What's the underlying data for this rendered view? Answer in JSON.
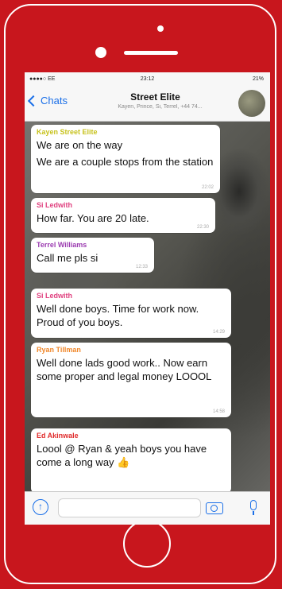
{
  "status": {
    "carrier": "●●●●○ EE",
    "time": "23:12",
    "battery": "21%"
  },
  "nav": {
    "back_label": "Chats",
    "title": "Street Elite",
    "subtitle": "Kayen, Prince, Si, Terrel, +44 74..."
  },
  "messages": [
    {
      "sender": "Kayen Street Elite",
      "color": "#c7c21c",
      "lines": [
        "We are on the way",
        "We are a couple stops from the station"
      ],
      "time": "22:02"
    },
    {
      "sender": "Si Ledwith",
      "color": "#e0407f",
      "lines": [
        "How far. You are 20 late."
      ],
      "time": "22:30"
    },
    {
      "sender": "Terrel Williams",
      "color": "#9b3bb0",
      "lines": [
        "Call me pls si"
      ],
      "time": "12:33"
    },
    {
      "sender": "Si Ledwith",
      "color": "#e0407f",
      "lines": [
        "Well done boys. Time for work now. Proud of you boys."
      ],
      "time": "14:29"
    },
    {
      "sender": "Ryan Tillman",
      "color": "#f0872a",
      "lines": [
        "Well done lads good work.. Now earn some proper and legal money LOOOL"
      ],
      "time": "14:58"
    },
    {
      "sender": "Ed Akinwale",
      "color": "#e02c2c",
      "lines": [
        "Loool @ Ryan & yeah boys you have come a long way 👍"
      ],
      "time": ""
    }
  ],
  "icons": {
    "attach": "upload-icon",
    "camera": "camera-icon",
    "mic": "mic-icon",
    "home": "home-button"
  },
  "colors": {
    "frame": "#c8161d",
    "accent": "#1a6fe8"
  }
}
